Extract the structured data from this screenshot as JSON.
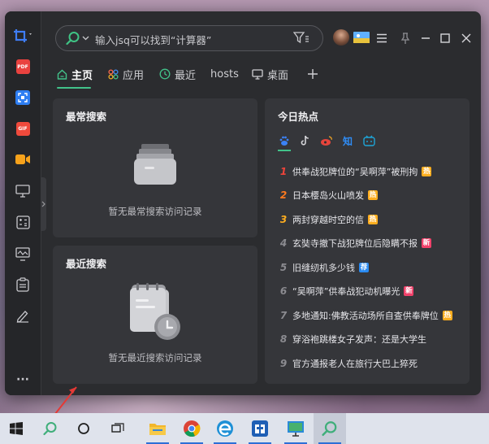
{
  "search": {
    "placeholder": "输入jsq可以找到“计算器”"
  },
  "tabs": [
    {
      "label": "主页",
      "icon": "home-icon",
      "active": true
    },
    {
      "label": "应用",
      "icon": "apps-icon",
      "active": false
    },
    {
      "label": "最近",
      "icon": "clock-icon",
      "active": false
    },
    {
      "label": "hosts",
      "icon": "",
      "active": false
    },
    {
      "label": "桌面",
      "icon": "monitor-icon",
      "active": false
    }
  ],
  "sidebar": {
    "items": [
      "screenshot-icon",
      "pdf-icon",
      "scan-icon",
      "gif-icon",
      "video-icon",
      "display-icon",
      "calculator-icon",
      "monitor-chart-icon",
      "clipboard-icon",
      "pen-icon"
    ],
    "pdf_label": "PDF",
    "gif_label": "GIF",
    "more_label": "···"
  },
  "most_search": {
    "title": "最常搜索",
    "empty": "暂无最常搜索访问记录"
  },
  "recent_search": {
    "title": "最近搜索",
    "empty": "暂无最近搜索访问记录"
  },
  "hot": {
    "title": "今日热点",
    "sources": [
      "baidu-icon",
      "douyin-icon",
      "weibo-icon",
      "zhihu-icon",
      "bilibili-icon"
    ],
    "zhihu_label": "知",
    "items": [
      {
        "rank": "1",
        "text": "供奉战犯牌位的“吴啊萍”被刑拘",
        "badge": "热",
        "badge_type": "hot"
      },
      {
        "rank": "2",
        "text": "日本樱岛火山喷发",
        "badge": "热",
        "badge_type": "hot"
      },
      {
        "rank": "3",
        "text": "两封穿越时空的信",
        "badge": "热",
        "badge_type": "hot"
      },
      {
        "rank": "4",
        "text": "玄奘寺撤下战犯牌位后隐瞒不报",
        "badge": "新",
        "badge_type": "new"
      },
      {
        "rank": "5",
        "text": "旧缝纫机多少钱",
        "badge": "荐",
        "badge_type": "jian"
      },
      {
        "rank": "6",
        "text": "“吴啊萍”供奉战犯动机曝光",
        "badge": "新",
        "badge_type": "new"
      },
      {
        "rank": "7",
        "text": "多地通知:佛教活动场所自查供奉牌位",
        "badge": "热",
        "badge_type": "hot"
      },
      {
        "rank": "8",
        "text": "穿浴袍跳楼女子发声：还是大学生",
        "badge": "",
        "badge_type": ""
      },
      {
        "rank": "9",
        "text": "官方通报老人在旅行大巴上猝死",
        "badge": "",
        "badge_type": ""
      }
    ]
  },
  "taskbar": [
    "windows-start-icon",
    "search-icon",
    "cortana-icon",
    "task-view-icon",
    "file-explorer-icon",
    "chrome-icon",
    "edge-icon",
    "app-icon",
    "remote-desktop-icon",
    "search-app-icon"
  ],
  "colors": {
    "accent": "#42c28a",
    "window_bg": "#2b2c2f",
    "card_bg": "#35363a",
    "hot_red": "#f0443a"
  }
}
